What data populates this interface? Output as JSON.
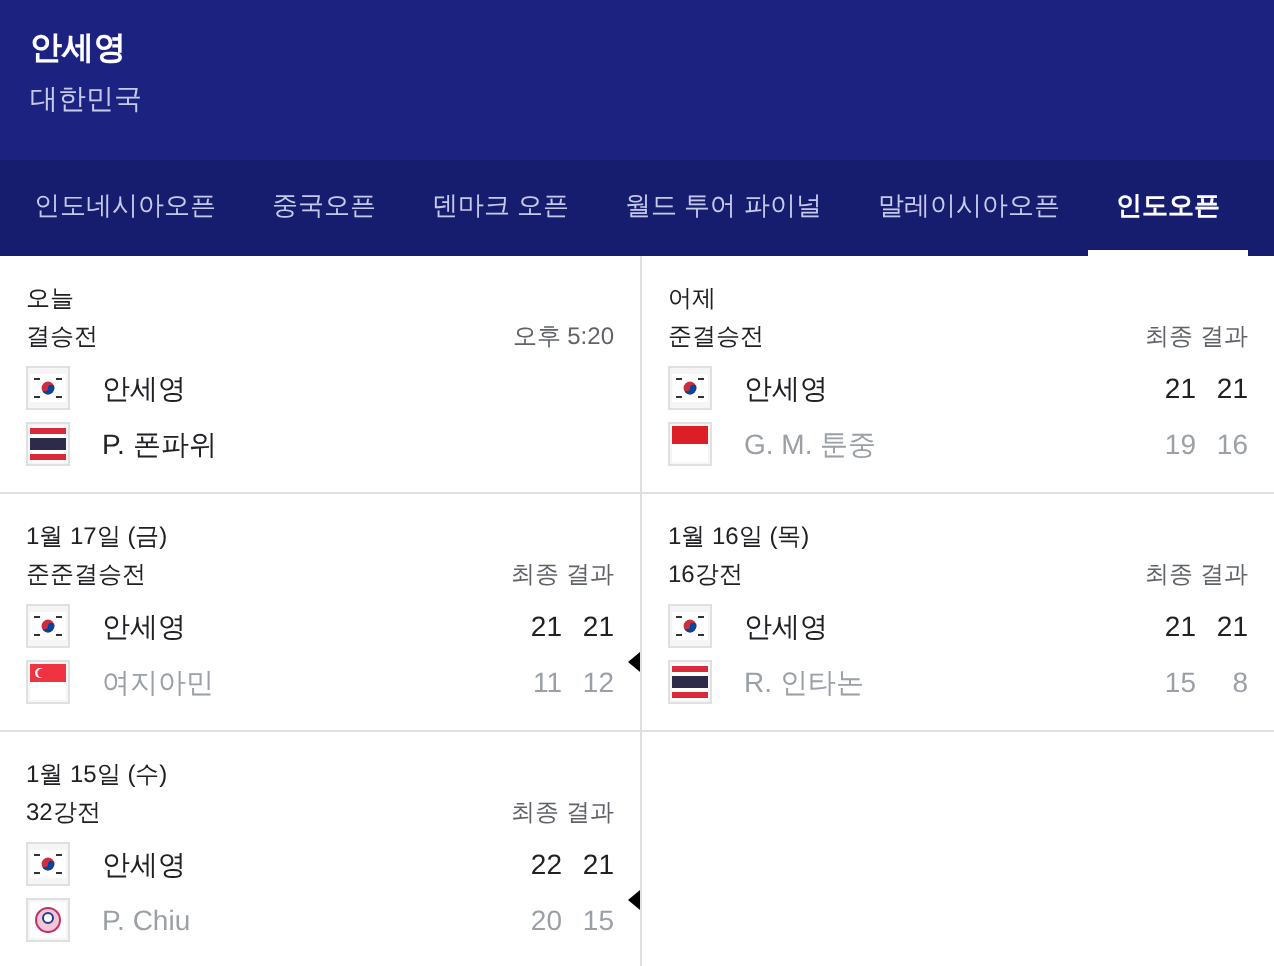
{
  "header": {
    "name": "안세영",
    "country": "대한민국"
  },
  "tabs": [
    {
      "label": "인도네시아오픈",
      "selected": false
    },
    {
      "label": "중국오픈",
      "selected": false
    },
    {
      "label": "덴마크 오픈",
      "selected": false
    },
    {
      "label": "월드 투어 파이널",
      "selected": false
    },
    {
      "label": "말레이시아오픈",
      "selected": false
    },
    {
      "label": "인도오픈",
      "selected": true
    }
  ],
  "matches": [
    {
      "date": "오늘",
      "round": "결승전",
      "status": "오후 5:20",
      "marked": false,
      "players": [
        {
          "name": "안세영",
          "kind": "kr",
          "won": true
        },
        {
          "name": "P. 폰파위",
          "kind": "th",
          "won": true
        }
      ]
    },
    {
      "date": "어제",
      "round": "준결승전",
      "status": "최종 결과",
      "marked": false,
      "players": [
        {
          "name": "안세영",
          "kind": "kr",
          "won": true,
          "scores": [
            "21",
            "21"
          ]
        },
        {
          "name": "G. M. 툰중",
          "kind": "id",
          "won": false,
          "scores": [
            "19",
            "16"
          ]
        }
      ]
    },
    {
      "date": "1월 17일 (금)",
      "round": "준준결승전",
      "status": "최종 결과",
      "marked": true,
      "players": [
        {
          "name": "안세영",
          "kind": "kr",
          "won": true,
          "scores": [
            "21",
            "21"
          ]
        },
        {
          "name": "여지아민",
          "kind": "sg",
          "won": false,
          "scores": [
            "11",
            "12"
          ]
        }
      ]
    },
    {
      "date": "1월 16일 (목)",
      "round": "16강전",
      "status": "최종 결과",
      "marked": false,
      "players": [
        {
          "name": "안세영",
          "kind": "kr",
          "won": true,
          "scores": [
            "21",
            "21"
          ]
        },
        {
          "name": "R. 인타논",
          "kind": "th",
          "won": false,
          "scores": [
            "15",
            "8"
          ]
        }
      ]
    },
    {
      "date": "1월 15일 (수)",
      "round": "32강전",
      "status": "최종 결과",
      "marked": true,
      "players": [
        {
          "name": "안세영",
          "kind": "kr",
          "won": true,
          "scores": [
            "22",
            "21"
          ]
        },
        {
          "name": "P. Chiu",
          "kind": "tw",
          "won": false,
          "scores": [
            "20",
            "15"
          ]
        }
      ]
    }
  ]
}
